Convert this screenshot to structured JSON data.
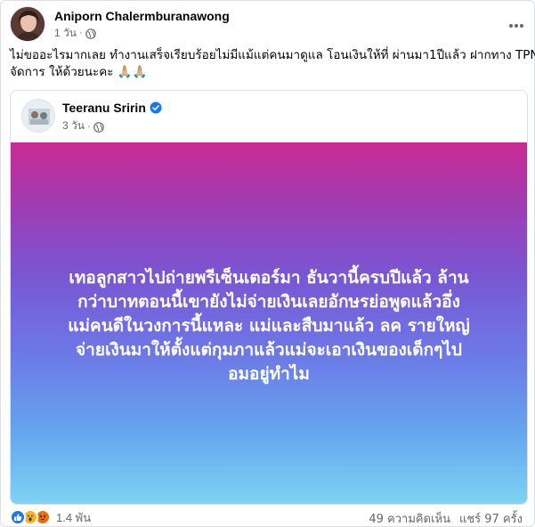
{
  "post": {
    "author_name": "Aniporn Chalermburanawong",
    "time": "1 วัน",
    "dot": "·",
    "caption_lines": [
      "ไม่ขออะไรมากเลย ทำงานเสร็จเรียบร้อยไม่มีแม้แต่คนมาดูแล โอนเงินให้ที่ ผ่านมา1ปีแล้ว ฝากทาง TPN",
      "จัดการ ให้ด้วยนะคะ 🙏🏼🙏🏼"
    ]
  },
  "shared_post": {
    "author_name": "Teeranu Sririn",
    "time": "3 วัน",
    "dot": "·",
    "banner_lines": [
      "เทอลูกสาวไปถ่ายพรีเซ็นเตอร์มา ธันวานี้ครบปีแล้ว ล้าน",
      "กว่าบาทตอนนี้เขายังไม่จ่ายเงินเลยอักษรย่อพูดแล้วอึ่ง",
      "แม่คนดีในวงการนี้แหละ แม่และสืบมาแล้ว ลค รายใหญ่",
      "จ่ายเงินมาให้ตั้งแต่กุมภาแล้วแม่จะเอาเงินของเด็กๆไป",
      "อมอยู่ทำไม"
    ]
  },
  "footer": {
    "reaction_count": "1.4 พัน",
    "comments": "49 ความคิดเห็น",
    "shares": "แชร์ 97 ครั้ง"
  },
  "colors": {
    "banner_top": "#c92a93",
    "banner_bottom": "#7fd4f4",
    "like": "#1877f2",
    "wow": "#f7b125",
    "angry": "#e9710f",
    "verified": "#1877f2"
  },
  "icons": [
    "globe-icon",
    "more-options-icon",
    "verified-icon",
    "like-icon",
    "wow-icon",
    "angry-icon"
  ]
}
